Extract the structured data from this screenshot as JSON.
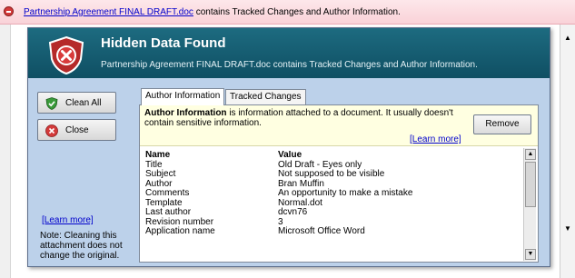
{
  "notification": {
    "filename": "Partnership Agreement FINAL DRAFT.doc",
    "message": " contains Tracked Changes and Author Information."
  },
  "dialog": {
    "title": "Hidden Data Found",
    "subtitle": "Partnership Agreement FINAL DRAFT.doc contains Tracked Changes and Author Information.",
    "buttons": {
      "clean_all": "Clean All",
      "close": "Close",
      "remove": "Remove"
    },
    "note_lines": [
      "Note: Cleaning this",
      "attachment does not",
      "change the original."
    ],
    "note_link": "[Learn more]",
    "tabs": [
      "Author Information",
      "Tracked Changes"
    ],
    "info": {
      "bold": "Author Information",
      "rest": " is information attached to a document.  It usually doesn't contain sensitive information.",
      "learn_more": "[Learn more]"
    },
    "properties": {
      "header": {
        "name": "Name",
        "value": "Value"
      },
      "rows": [
        {
          "name": "Title",
          "value": "Old Draft - Eyes only"
        },
        {
          "name": "Subject",
          "value": "Not supposed to be visible"
        },
        {
          "name": "Author",
          "value": "Bran Muffin"
        },
        {
          "name": "Comments",
          "value": "An opportunity to make a mistake"
        },
        {
          "name": "Template",
          "value": "Normal.dot"
        },
        {
          "name": "Last author",
          "value": "dcvn76"
        },
        {
          "name": "Revision number",
          "value": "3"
        },
        {
          "name": "Application name",
          "value": "Microsoft Office Word"
        }
      ]
    }
  },
  "colors": {
    "header": "#0f4f63",
    "body": "#bcd1ea",
    "info": "#ffffe1",
    "link": "#0000cc",
    "notify": "#f9d2d8"
  },
  "icons": [
    "warning-icon",
    "shield-x-icon",
    "shield-check-icon",
    "close-icon",
    "scroll-up-icon",
    "scroll-down-icon"
  ]
}
